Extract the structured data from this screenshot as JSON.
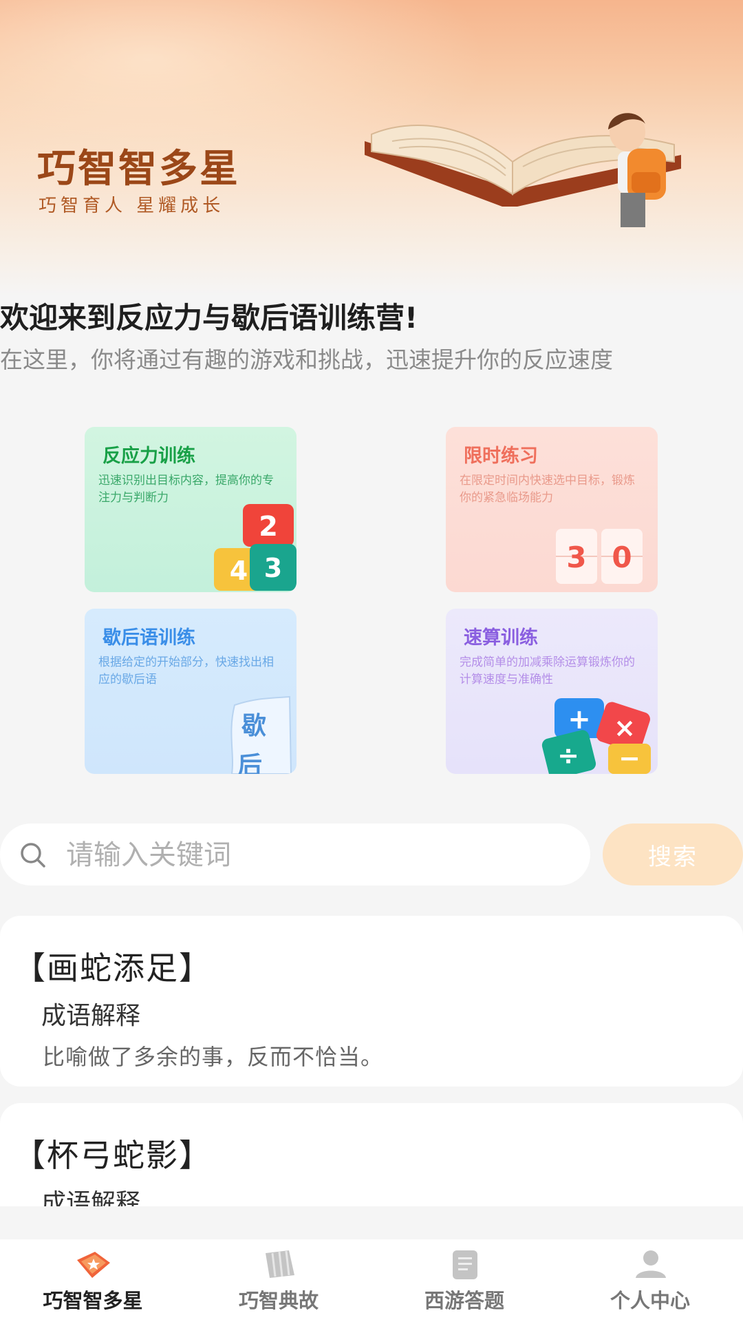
{
  "hero": {
    "title": "巧智智多星",
    "subtitle": "巧智育人 星耀成长"
  },
  "intro": {
    "title": "欢迎来到反应力与歇后语训练营!",
    "description": "在这里，你将通过有趣的游戏和挑战，迅速提升你的反应速度"
  },
  "features": [
    {
      "title": "反应力训练",
      "description": "迅速识别出目标内容，提高你的专注力与判断力",
      "art": [
        "2",
        "3",
        "4"
      ]
    },
    {
      "title": "限时练习",
      "description": "在限定时间内快速选中目标，锻炼你的紧急临场能力",
      "art": [
        "3",
        "0"
      ]
    },
    {
      "title": "歇后语训练",
      "description": "根据给定的开始部分，快速找出相应的歇后语",
      "art": [
        "歇",
        "后"
      ]
    },
    {
      "title": "速算训练",
      "description": "完成简单的加减乘除运算锻炼你的计算速度与准确性",
      "art": [
        "+",
        "×",
        "÷",
        "−"
      ]
    }
  ],
  "search": {
    "placeholder": "请输入关键词",
    "button_label": "搜索"
  },
  "idioms": [
    {
      "name": "【画蛇添足】",
      "label": "成语解释",
      "meaning": "比喻做了多余的事，反而不恰当。"
    },
    {
      "name": "【杯弓蛇影】",
      "label": "成语解释",
      "meaning": ""
    }
  ],
  "nav": {
    "items": [
      {
        "label": "巧智智多星",
        "icon": "book-star-icon",
        "active": true
      },
      {
        "label": "巧智典故",
        "icon": "scroll-icon",
        "active": false
      },
      {
        "label": "西游答题",
        "icon": "quiz-icon",
        "active": false
      },
      {
        "label": "个人中心",
        "icon": "user-icon",
        "active": false
      }
    ]
  },
  "colors": {
    "accent": "#f0643a",
    "search_button": "#fde3c3",
    "reaction": "#18a047",
    "timed": "#ef6f5c",
    "xiehouyu": "#3a8ee8",
    "calc": "#8a5fe0"
  }
}
